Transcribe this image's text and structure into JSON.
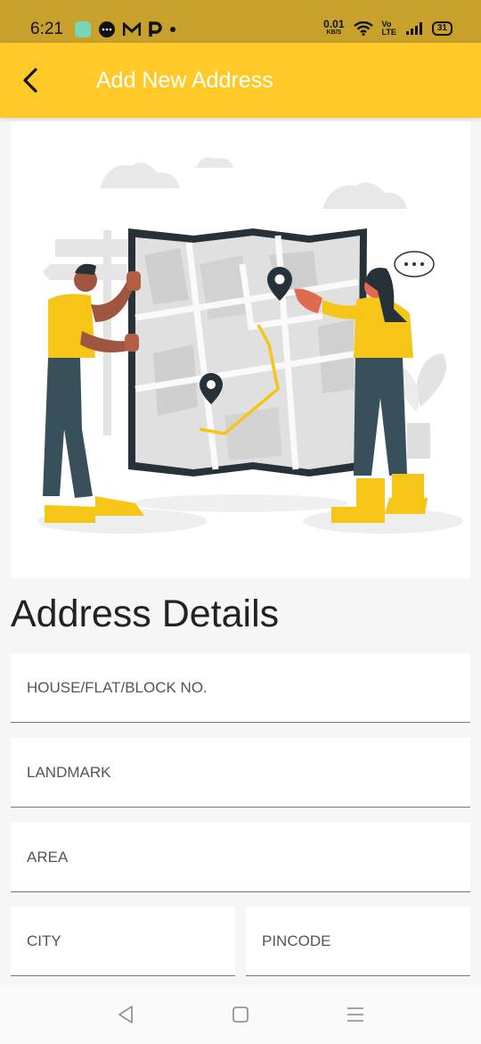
{
  "status_bar": {
    "time": "6:21",
    "net_speed": "0.01",
    "net_unit": "KB/S",
    "volte_top": "Vo",
    "volte_bottom": "LTE",
    "battery": "31"
  },
  "app_bar": {
    "title": "Add New Address",
    "back_icon": "chevron-left-icon"
  },
  "illustration": {
    "name": "map-people-illustration"
  },
  "section": {
    "title": "Address Details"
  },
  "form": {
    "house": {
      "placeholder": "HOUSE/FLAT/BLOCK NO.",
      "value": ""
    },
    "landmark": {
      "placeholder": "LANDMARK",
      "value": ""
    },
    "area": {
      "placeholder": "AREA",
      "value": ""
    },
    "city": {
      "placeholder": "CITY",
      "value": ""
    },
    "pincode": {
      "placeholder": "PINCODE",
      "value": ""
    }
  },
  "colors": {
    "primary": "#ffca28",
    "status_bar": "#c7a12b",
    "accent_illus": "#f5c518",
    "dark_illus": "#263238"
  }
}
